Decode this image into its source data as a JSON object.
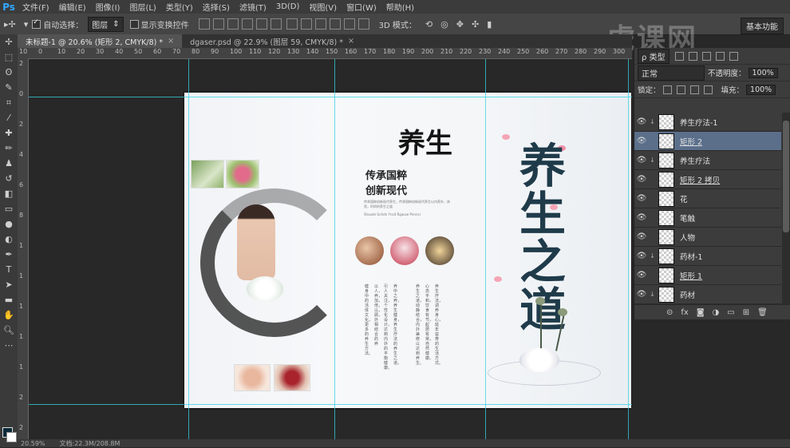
{
  "app": {
    "logo": "Ps"
  },
  "menu": [
    "文件(F)",
    "编辑(E)",
    "图像(I)",
    "图层(L)",
    "类型(Y)",
    "选择(S)",
    "滤镜(T)",
    "3D(D)",
    "视图(V)",
    "窗口(W)",
    "帮助(H)"
  ],
  "options": {
    "auto_select_label": "自动选择：",
    "auto_select_value": "图层",
    "show_transform_label": "显示变换控件",
    "mode_3d_label": "3D 模式：",
    "workspace": "基本功能"
  },
  "watermark": "虎课网",
  "tabs": [
    {
      "label": "未标题-1 @ 20.6% (矩形 2, CMYK/8) *",
      "close": "×",
      "active": true
    },
    {
      "label": "dgaser.psd @ 22.9% (图层 59, CMYK/8) *",
      "close": "×",
      "active": false
    }
  ],
  "rulers": {
    "top": [
      "10",
      "0",
      "10",
      "20",
      "30",
      "40",
      "50",
      "60",
      "70",
      "80",
      "90",
      "100",
      "110",
      "120",
      "130",
      "140",
      "150",
      "160",
      "170",
      "180",
      "190",
      "200",
      "210",
      "220",
      "230",
      "240",
      "250",
      "260",
      "270",
      "280",
      "290",
      "300"
    ],
    "left": [
      "2",
      "0",
      "2",
      "4",
      "6",
      "8",
      "1",
      "1",
      "1",
      "1",
      "1",
      "2",
      "2"
    ]
  },
  "document": {
    "title_small": "养生",
    "title_big": "养生之道",
    "headline_line1": "传承国粹",
    "headline_line2": "创新现代",
    "sub_english": "Shoude Gchdn Yncd Rgaose Pnnncr",
    "body_snippet": "传承国粹创新现代养生，传承国粹创新现代养生以内养外，体验，时尚的养生之道",
    "column_text": [
      "健身中的活体文化，更多的养生方法。",
      "以人，养，加，倍，以，顾，外相结合的养",
      "引人关注，个性化设计，达到内外的平衡健康。",
      "养中之养，养生健身，养生疗法的养生之道。",
      "养生之道，动静结合，内外兼修以达到养生。",
      "心态平和，饮食有节，起居有常，自然健康。",
      "养生疗法，调养身心，延年益寿的生活方式。"
    ]
  },
  "layers_panel": {
    "filter_label": "ρ 类型",
    "blend_mode": "正常",
    "opacity_label": "不透明度：",
    "opacity_value": "100%",
    "lock_label": "锁定：",
    "fill_label": "填充：",
    "fill_value": "100%",
    "layers": [
      {
        "name": "养生疗法-1",
        "visible": true,
        "clipped": true,
        "selected": false,
        "underline": false
      },
      {
        "name": "矩形 2",
        "visible": true,
        "clipped": false,
        "selected": true,
        "underline": true
      },
      {
        "name": "养生疗法",
        "visible": true,
        "clipped": true,
        "selected": false,
        "underline": false
      },
      {
        "name": "矩形 2 拷贝",
        "visible": true,
        "clipped": false,
        "selected": false,
        "underline": true
      },
      {
        "name": "花",
        "visible": true,
        "clipped": false,
        "selected": false,
        "underline": false
      },
      {
        "name": "笔触",
        "visible": true,
        "clipped": false,
        "selected": false,
        "underline": false
      },
      {
        "name": "人物",
        "visible": true,
        "clipped": false,
        "selected": false,
        "underline": false
      },
      {
        "name": "药材-1",
        "visible": true,
        "clipped": true,
        "selected": false,
        "underline": false
      },
      {
        "name": "矩形 1",
        "visible": true,
        "clipped": false,
        "selected": false,
        "underline": true
      },
      {
        "name": "药材",
        "visible": true,
        "clipped": true,
        "selected": false,
        "underline": false
      }
    ],
    "footer_icons": [
      "link-icon",
      "fx-icon",
      "mask-icon",
      "adjustment-icon",
      "folder-icon",
      "new-layer-icon",
      "trash-icon"
    ]
  },
  "status": {
    "zoom": "20.59%",
    "doc_size": "文档:22.3M/208.8M"
  },
  "colors": {
    "guide": "#36d0e0",
    "selection": "#5b6f8b",
    "foreground": "#0b2a3a",
    "background": "#ffffff"
  }
}
